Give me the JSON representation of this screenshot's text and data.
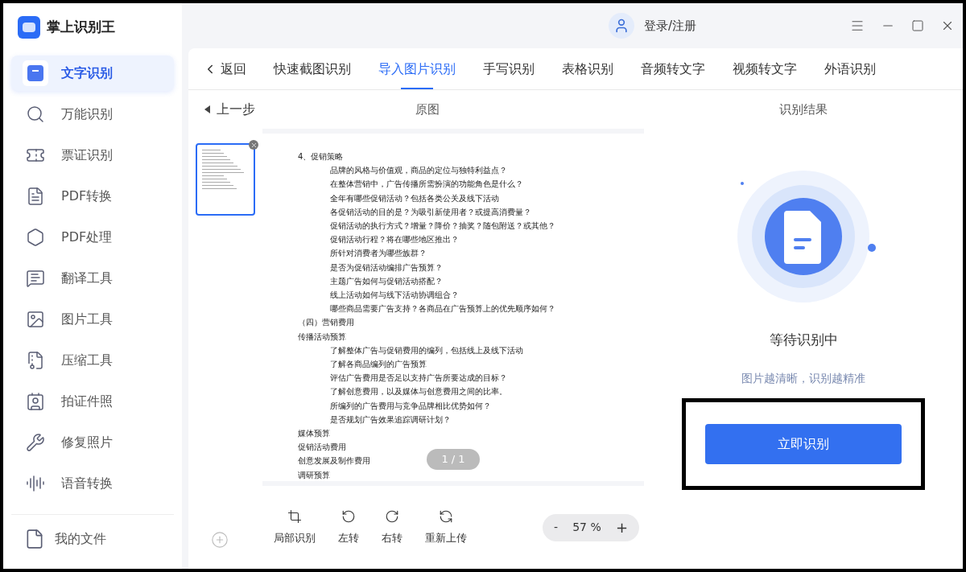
{
  "app": {
    "name": "掌上识别王"
  },
  "sidebar": {
    "items": [
      {
        "label": "文字识别",
        "selected": true
      },
      {
        "label": "万能识别",
        "selected": false
      },
      {
        "label": "票证识别",
        "selected": false
      },
      {
        "label": "PDF转换",
        "selected": false
      },
      {
        "label": "PDF处理",
        "selected": false
      },
      {
        "label": "翻译工具",
        "selected": false
      },
      {
        "label": "图片工具",
        "selected": false
      },
      {
        "label": "压缩工具",
        "selected": false
      },
      {
        "label": "拍证件照",
        "selected": false
      },
      {
        "label": "修复照片",
        "selected": false
      },
      {
        "label": "语音转换",
        "selected": false
      }
    ],
    "footer": {
      "label": "我的文件"
    }
  },
  "titlebar": {
    "login": "登录/注册"
  },
  "tabs": {
    "back": "返回",
    "items": [
      {
        "label": "快速截图识别",
        "selected": false
      },
      {
        "label": "导入图片识别",
        "selected": true
      },
      {
        "label": "手写识别",
        "selected": false
      },
      {
        "label": "表格识别",
        "selected": false
      },
      {
        "label": "音频转文字",
        "selected": false
      },
      {
        "label": "视频转文字",
        "selected": false
      },
      {
        "label": "外语识别",
        "selected": false
      }
    ]
  },
  "subheader": {
    "prev": "上一步",
    "original": "原图",
    "result": "识别结果"
  },
  "document": {
    "lines": [
      {
        "text": "4、促销策略",
        "children": [
          {
            "text": "品牌的风格与价值观，商品的定位与独特利益点？"
          },
          {
            "text": "在整体营销中，广告传播所需扮演的功能角色是什么？"
          },
          {
            "text": "全年有哪些促销活动？包括各类公关及线下活动"
          },
          {
            "text": "各促销活动的目的是？为吸引新使用者？或提高消费量？"
          },
          {
            "text": "促销活动的执行方式？增量？降价？抽奖？随包附送？或其他？"
          },
          {
            "text": "促销活动行程？将在哪些地区推出？"
          },
          {
            "text": "所针对消费者为哪些族群？"
          },
          {
            "text": "是否为促销活动编排广告预算？"
          },
          {
            "text": "主题广告如何与促销活动搭配？"
          },
          {
            "text": "线上活动如何与线下活动协调组合？"
          },
          {
            "text": "哪些商品需要广告支持？各商品在广告预算上的优先顺序如何？"
          }
        ]
      },
      {
        "text": "（四）营销费用"
      },
      {
        "text": "传播活动预算",
        "children": [
          {
            "text": "了解整体广告与促销费用的编列，包括线上及线下活动"
          },
          {
            "text": "了解各商品编列的广告预算"
          },
          {
            "text": "评估广告费用是否足以支持广告所要达成的目标？"
          },
          {
            "text": "了解创意费用，以及媒体与创意费用之间的比率。"
          },
          {
            "text": "所编列的广告费用与竞争品牌相比优势如何？"
          },
          {
            "text": "是否规划广告效果追踪调研计划？"
          }
        ]
      },
      {
        "text": "媒体预算"
      },
      {
        "text": "促销活动费用"
      },
      {
        "text": "创意发展及制作费用"
      },
      {
        "text": "调研预算"
      }
    ],
    "page": "1 / 1"
  },
  "toolbar": [
    {
      "label": "局部识别"
    },
    {
      "label": "左转"
    },
    {
      "label": "右转"
    },
    {
      "label": "重新上传"
    }
  ],
  "zoom": {
    "minus": "-",
    "value": "57 %",
    "plus": "+"
  },
  "result": {
    "status": "等待识别中",
    "hint": "图片越清晰，识别越精准",
    "button": "立即识别"
  }
}
